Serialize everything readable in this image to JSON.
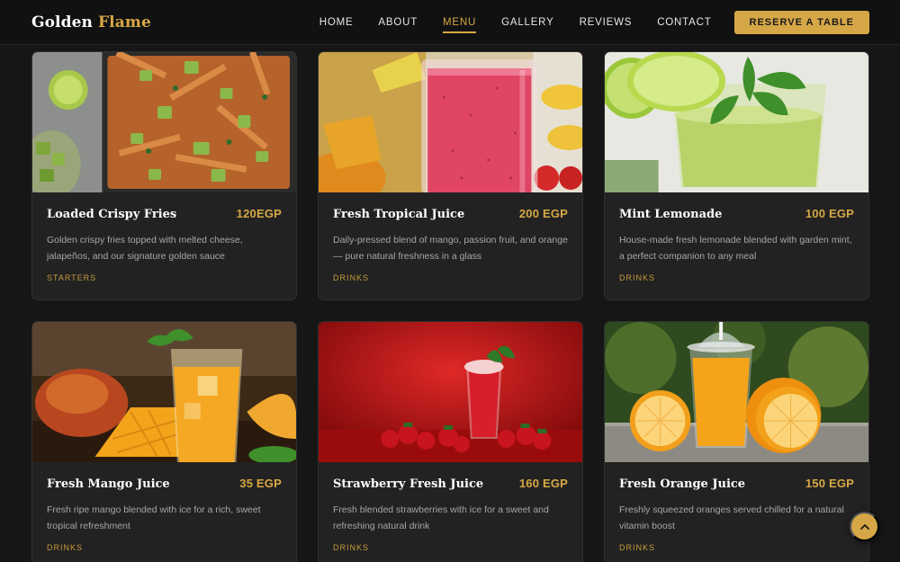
{
  "nav": {
    "brand_main": "Golden",
    "brand_accent": "Flame",
    "links": [
      "HOME",
      "ABOUT",
      "MENU",
      "GALLERY",
      "REVIEWS",
      "CONTACT"
    ],
    "active": "MENU",
    "reserve_label": "RESERVE A TABLE"
  },
  "menu": {
    "items": [
      {
        "title": "Loaded Crispy Fries",
        "price": "120EGP",
        "description": "Golden crispy fries topped with melted cheese, jalapeños, and our signature golden sauce",
        "category": "STARTERS",
        "image": "loaded-fries-photo"
      },
      {
        "title": "Fresh Tropical Juice",
        "price": "200 EGP",
        "description": "Daily-pressed blend of mango, passion fruit, and orange — pure natural freshness in a glass",
        "category": "DRINKS",
        "image": "tropical-juice-photo"
      },
      {
        "title": "Mint Lemonade",
        "price": "100 EGP",
        "description": "House-made fresh lemonade blended with garden mint, a perfect companion to any meal",
        "category": "DRINKS",
        "image": "mint-lemonade-photo"
      },
      {
        "title": "Fresh Mango Juice",
        "price": "35 EGP",
        "description": "Fresh ripe mango blended with ice for a rich, sweet tropical refreshment",
        "category": "DRINKS",
        "image": "mango-juice-photo"
      },
      {
        "title": "Strawberry Fresh Juice",
        "price": "160 EGP",
        "description": "Fresh blended strawberries with ice for a sweet and refreshing natural drink",
        "category": "DRINKS",
        "image": "strawberry-juice-photo"
      },
      {
        "title": "Fresh Orange Juice",
        "price": "150 EGP",
        "description": "Freshly squeezed oranges served chilled for a natural vitamin boost",
        "category": "DRINKS",
        "image": "orange-juice-photo"
      }
    ]
  },
  "scroll_top": {
    "icon": "chevron-up-icon"
  },
  "colors": {
    "accent": "#d8a845",
    "background": "#161616",
    "card": "#222222"
  }
}
